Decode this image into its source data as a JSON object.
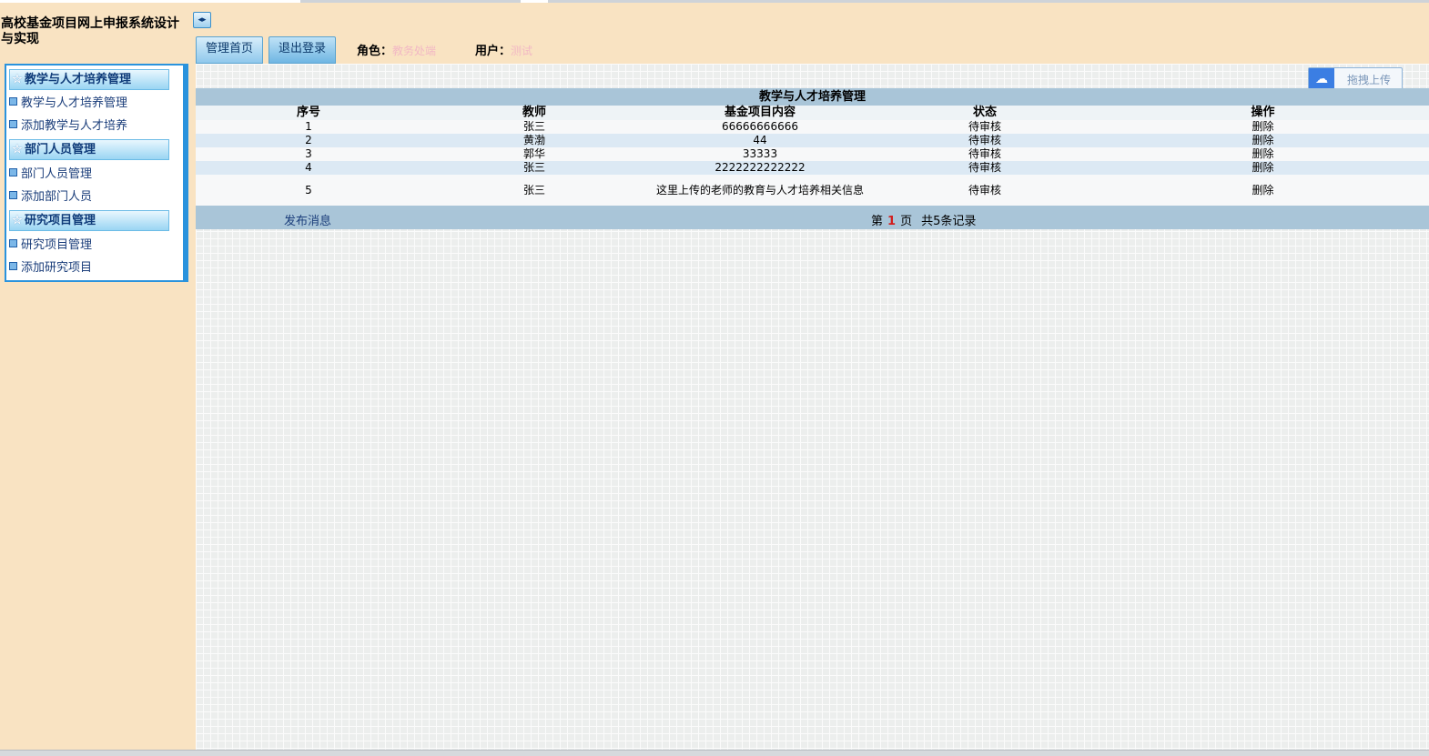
{
  "app": {
    "title": "高校基金项目网上申报系统设计与实现"
  },
  "header": {
    "toggle_icon": "◂▸",
    "buttons": {
      "home": "管理首页",
      "logout": "退出登录"
    },
    "role_label": "角色：",
    "role_value": "教务处端",
    "user_label": "用户：",
    "user_value": "测试"
  },
  "sidebar": {
    "groups": [
      {
        "title": "教学与人才培养管理",
        "items": [
          "教学与人才培养管理",
          "添加教学与人才培养"
        ]
      },
      {
        "title": "部门人员管理",
        "items": [
          "部门人员管理",
          "添加部门人员"
        ]
      },
      {
        "title": "研究项目管理",
        "items": [
          "研究项目管理",
          "添加研究项目"
        ]
      }
    ]
  },
  "main": {
    "upload_button": "拖拽上传",
    "table": {
      "title": "教学与人才培养管理",
      "headers": [
        "序号",
        "教师",
        "基金项目内容",
        "状态",
        "操作"
      ],
      "rows": [
        {
          "no": "1",
          "teacher": "张三",
          "content": "66666666666",
          "status": "待审核",
          "action": "删除"
        },
        {
          "no": "2",
          "teacher": "黄渤",
          "content": "44",
          "status": "待审核",
          "action": "删除"
        },
        {
          "no": "3",
          "teacher": "郭华",
          "content": "33333",
          "status": "待审核",
          "action": "删除"
        },
        {
          "no": "4",
          "teacher": "张三",
          "content": "2222222222222",
          "status": "待审核",
          "action": "删除"
        },
        {
          "no": "5",
          "teacher": "张三",
          "content": "这里上传的老师的教育与人才培养相关信息",
          "status": "待审核",
          "action": "删除"
        }
      ]
    },
    "footer": {
      "publish": "发布消息",
      "page_prefix": "第",
      "page_current": "1",
      "page_suffix": "页",
      "total": "共5条记录"
    }
  }
}
